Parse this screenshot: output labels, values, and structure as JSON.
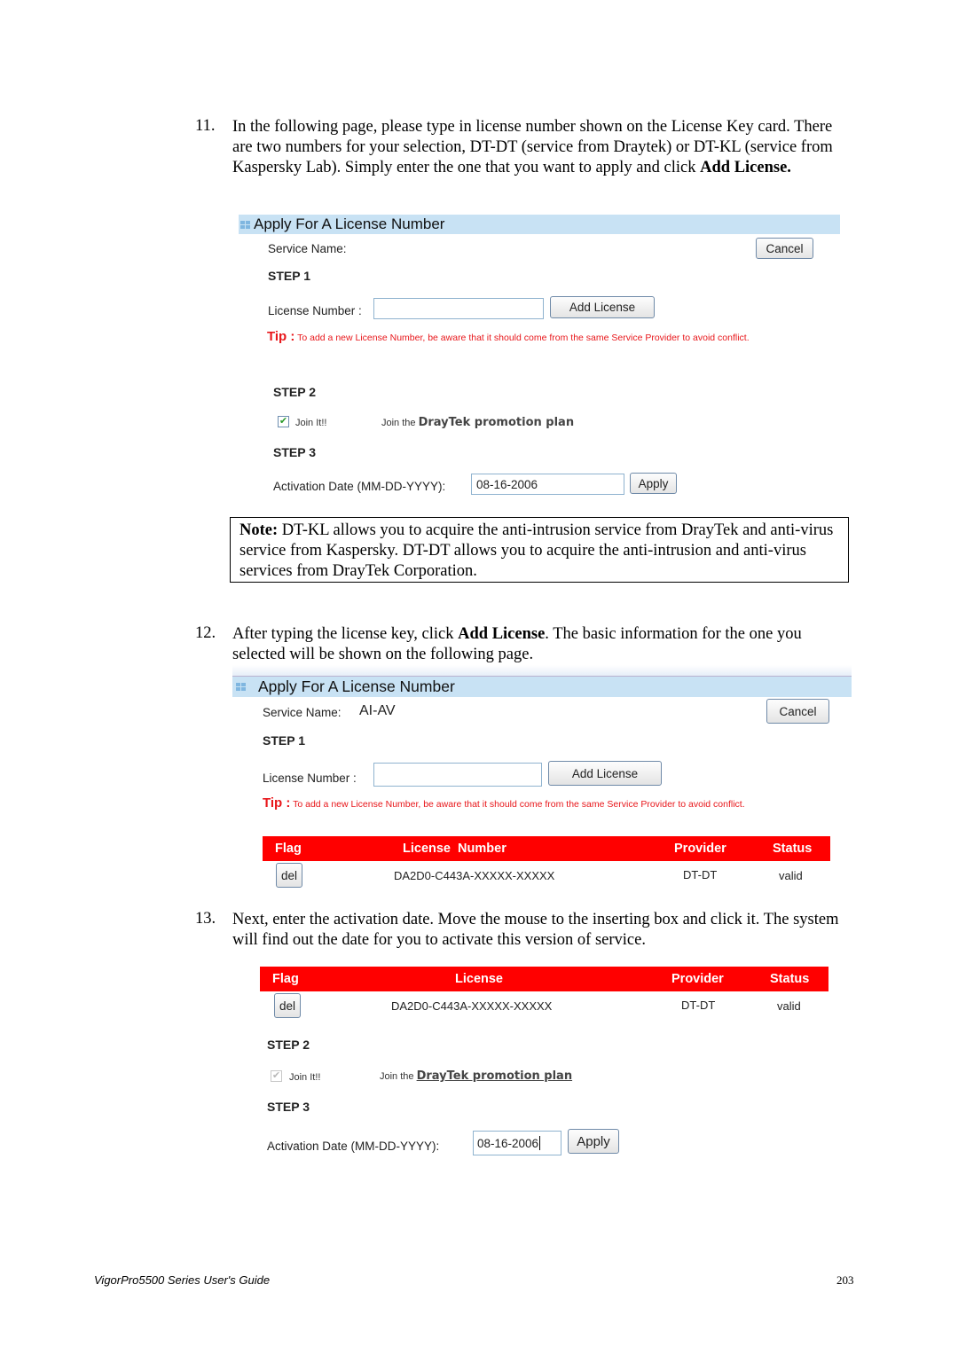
{
  "steps": {
    "s11": {
      "number": "11.",
      "text": "In the following page, please type in license number shown on the License Key card. There are two numbers for your selection, DT-DT (service from Draytek) or DT-KL (service from Kaspersky Lab). Simply enter the one that you want to apply and click",
      "bold_tail": "Add License."
    },
    "s12": {
      "number": "12.",
      "text_before": "After typing the license key, click ",
      "bold": "Add License",
      "text_after": ". The basic information for the one you selected will be shown on the following page."
    },
    "s13": {
      "number": "13.",
      "text": "Next, enter the activation date. Move the mouse to the inserting box and click it. The system will find out the date for you to activate this version of service."
    }
  },
  "note": {
    "label": "Note:",
    "text": " DT-KL allows you to acquire the anti-intrusion service from DrayTek and anti-virus service from Kaspersky. DT-DT allows you to acquire the anti-intrusion and anti-virus services from DrayTek Corporation."
  },
  "screen1": {
    "title": "Apply For A License Number",
    "service_name_label": "Service Name:",
    "service_name_value": "",
    "cancel_label": "Cancel",
    "step1": "STEP 1",
    "license_number_label": "License Number :",
    "license_number_value": "",
    "add_license_label": "Add License",
    "tip_label": "Tip :",
    "tip_text": " To add a new License Number, be aware that it should come from the same Service Provider to avoid conflict.",
    "step2": "STEP 2",
    "join_label": "Join It!!",
    "join_checked": true,
    "join_the": "Join the",
    "promo_text": "DrayTek promotion plan",
    "step3": "STEP 3",
    "activation_label": "Activation Date (MM-DD-YYYY):",
    "activation_value": "08-16-2006",
    "apply_label": "Apply"
  },
  "screen2": {
    "title": "Apply For A License Number",
    "service_name_label": "Service Name:",
    "service_name_value": "AI-AV",
    "cancel_label": "Cancel",
    "step1": "STEP 1",
    "license_number_label": "License Number :",
    "license_number_value": "",
    "add_license_label": "Add License",
    "tip_label": "Tip :",
    "tip_text": " To add a new License Number, be aware that it should come from the same Service Provider to avoid conflict.",
    "table": {
      "headers": [
        "Flag",
        "License  Number",
        "Provider",
        "Status"
      ],
      "rows": [
        {
          "flag": "del",
          "license": "DA2D0-C443A-XXXXX-XXXXX",
          "provider": "DT-DT",
          "status": "valid"
        }
      ]
    }
  },
  "screen3": {
    "table": {
      "headers": [
        "Flag",
        "License",
        "Provider",
        "Status"
      ],
      "rows": [
        {
          "flag": "del",
          "license": "DA2D0-C443A-XXXXX-XXXXX",
          "provider": "DT-DT",
          "status": "valid"
        }
      ]
    },
    "step2": "STEP 2",
    "join_label": "Join It!!",
    "join_checked": true,
    "join_the": "Join the",
    "promo_text": "DrayTek promotion plan",
    "step3": "STEP 3",
    "activation_label": "Activation Date (MM-DD-YYYY):",
    "activation_value": "08-16-2006",
    "apply_label": "Apply"
  },
  "footer": {
    "guide_title": "VigorPro5500 Series User's Guide",
    "page_number": "203"
  }
}
